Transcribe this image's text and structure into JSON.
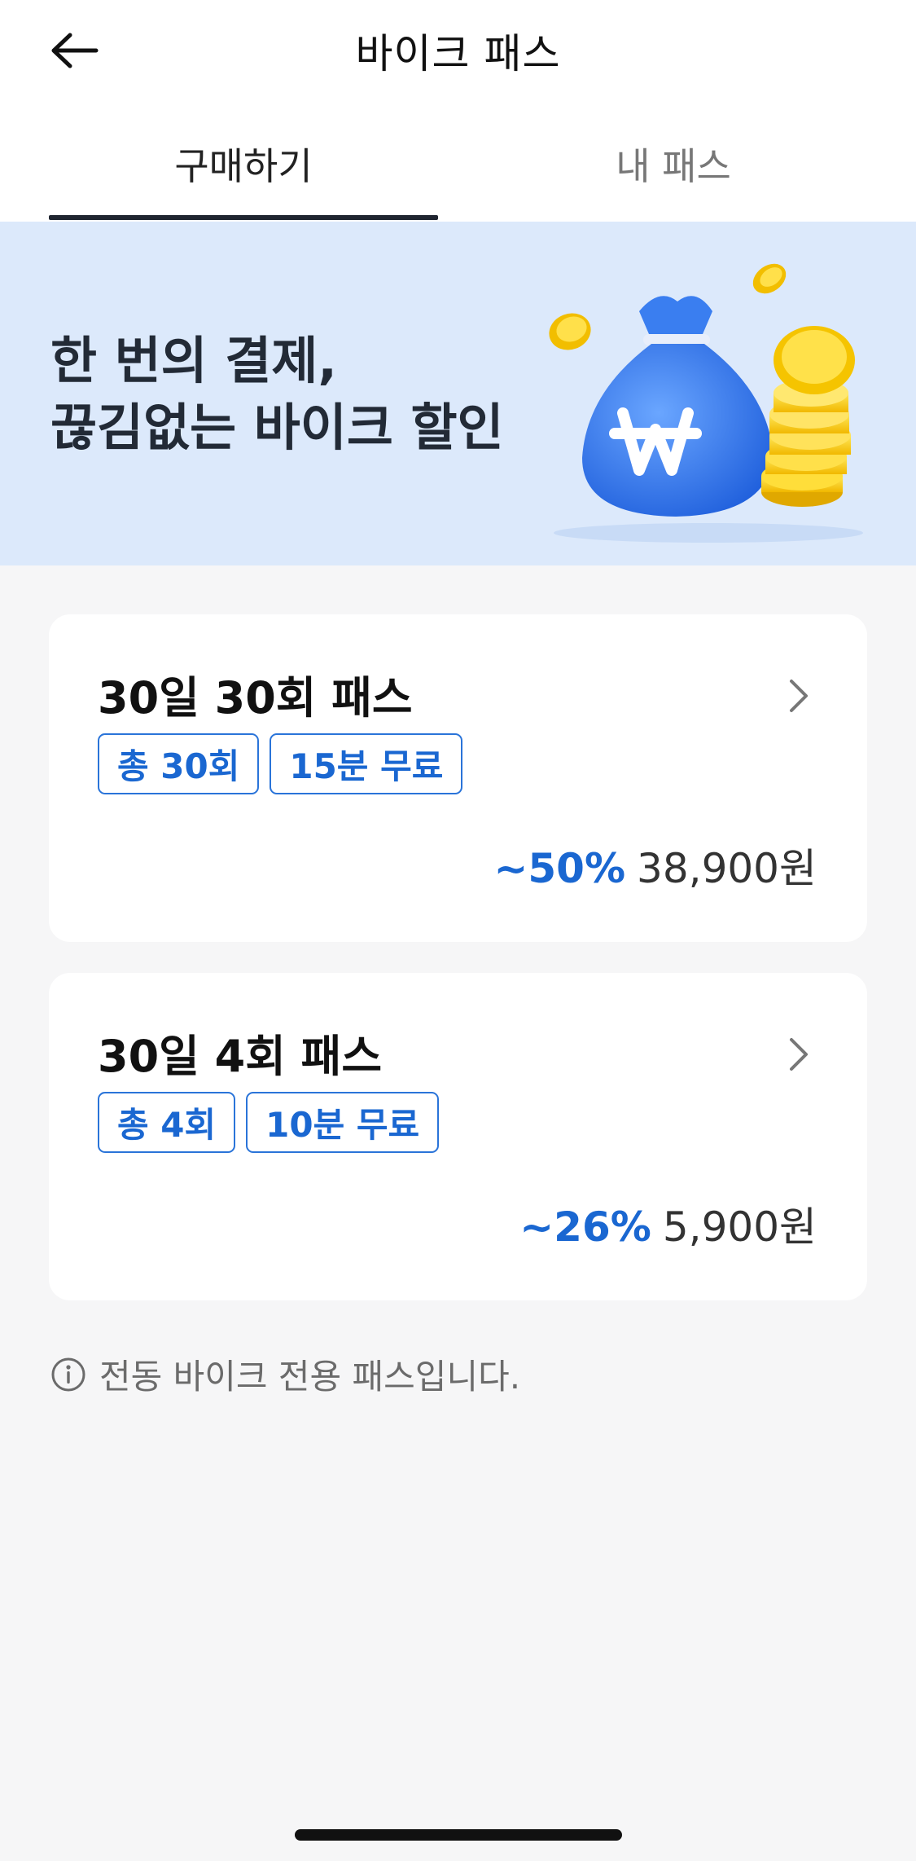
{
  "header": {
    "title": "바이크 패스",
    "back_icon": "arrow-left-icon"
  },
  "tabs": [
    {
      "label": "구매하기",
      "active": true
    },
    {
      "label": "내 패스",
      "active": false
    }
  ],
  "banner": {
    "line1": "한 번의 결제,",
    "line2": "끊김없는 바이크 할인",
    "illustration": "money-bag-coins-icon",
    "background": "#dce9fb"
  },
  "passes": [
    {
      "title": "30일 30회 패스",
      "tags": [
        "총 30회",
        "15분 무료"
      ],
      "discount": "~50%",
      "price": "38,900원"
    },
    {
      "title": "30일 4회 패스",
      "tags": [
        "총 4회",
        "10분 무료"
      ],
      "discount": "~26%",
      "price": "5,900원"
    }
  ],
  "notice": {
    "icon": "info-icon",
    "text": "전동 바이크 전용 패스입니다."
  },
  "colors": {
    "accent": "#1a67d1",
    "background": "#f6f6f7",
    "tab_indicator": "#1f2530"
  }
}
